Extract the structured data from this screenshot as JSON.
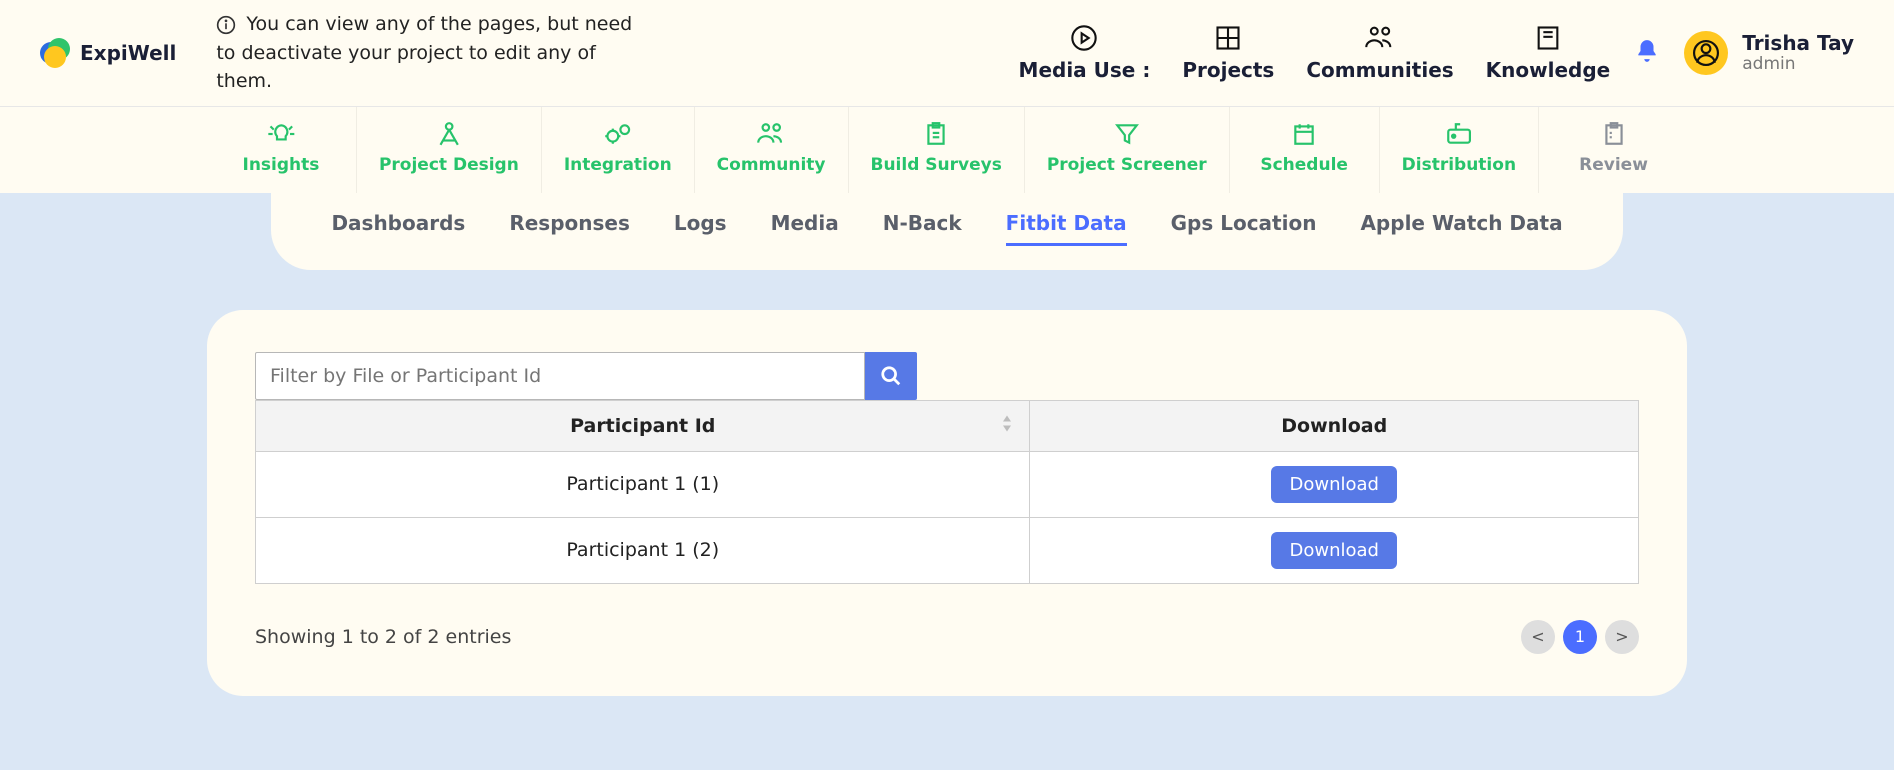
{
  "brand": "ExpiWell",
  "notice": "You can view any of the pages, but need to deactivate your project to edit any of them.",
  "main_nav": {
    "media": "Media Use :",
    "projects": "Projects",
    "communities": "Communities",
    "knowledge": "Knowledge"
  },
  "user": {
    "name": "Trisha Tay",
    "role": "admin"
  },
  "subnav": {
    "insights": "Insights",
    "project_design": "Project Design",
    "integration": "Integration",
    "community": "Community",
    "build_surveys": "Build Surveys",
    "project_screener": "Project Screener",
    "schedule": "Schedule",
    "distribution": "Distribution",
    "review": "Review"
  },
  "tabs": {
    "dashboards": "Dashboards",
    "responses": "Responses",
    "logs": "Logs",
    "media": "Media",
    "nback": "N-Back",
    "fitbit": "Fitbit Data",
    "gps": "Gps Location",
    "apple": "Apple Watch Data"
  },
  "search": {
    "placeholder": "Filter by File or Participant Id"
  },
  "table": {
    "col1": "Participant Id",
    "col2": "Download",
    "rows": [
      {
        "pid": "Participant 1 (1)",
        "btn": "Download"
      },
      {
        "pid": "Participant 1 (2)",
        "btn": "Download"
      }
    ]
  },
  "footer": {
    "showing": "Showing 1 to 2 of 2 entries",
    "prev": "<",
    "next": ">",
    "page": "1"
  }
}
